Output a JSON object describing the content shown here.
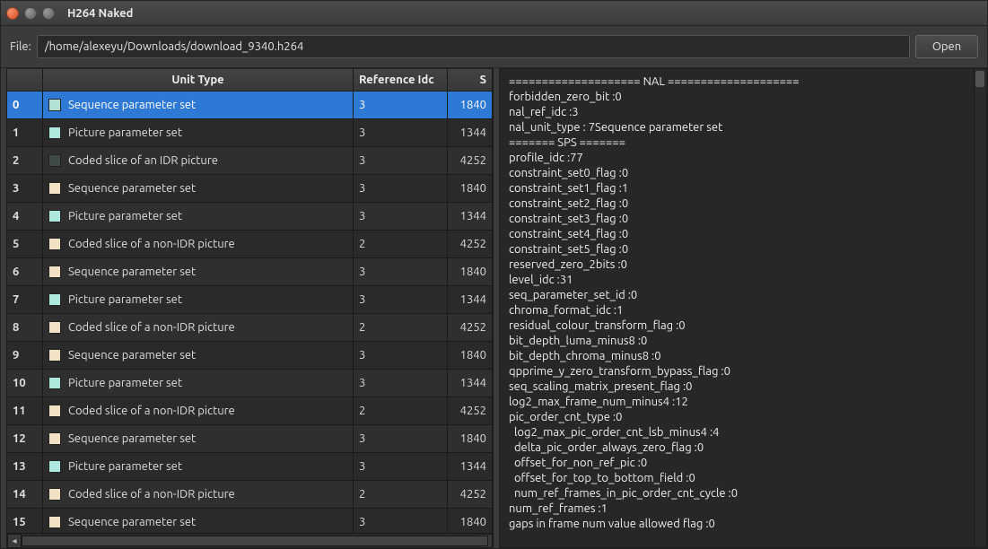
{
  "window": {
    "title": "H264 Naked"
  },
  "toolbar": {
    "file_label": "File:",
    "path": "/home/alexeyu/Downloads/download_9340.h264",
    "open_label": "Open"
  },
  "table": {
    "headers": {
      "type": "Unit Type",
      "ref": "Reference Idc",
      "size": "S"
    },
    "selected_index": 0,
    "rows": [
      {
        "idx": 0,
        "type": "Sequence parameter set",
        "ref": 3,
        "size": 1840,
        "color": "#b1e2d5"
      },
      {
        "idx": 1,
        "type": "Picture parameter set",
        "ref": 3,
        "size": 1344,
        "color": "#aee7dd"
      },
      {
        "idx": 2,
        "type": "Coded slice of an IDR picture",
        "ref": 3,
        "size": 4252,
        "color": "#3e4a44"
      },
      {
        "idx": 3,
        "type": "Sequence parameter set",
        "ref": 3,
        "size": 1840,
        "color": "#f2e2c4"
      },
      {
        "idx": 4,
        "type": "Picture parameter set",
        "ref": 3,
        "size": 1344,
        "color": "#aee7dd"
      },
      {
        "idx": 5,
        "type": "Coded slice of a non-IDR picture",
        "ref": 2,
        "size": 4252,
        "color": "#f2e2c4"
      },
      {
        "idx": 6,
        "type": "Sequence parameter set",
        "ref": 3,
        "size": 1840,
        "color": "#f2e2c4"
      },
      {
        "idx": 7,
        "type": "Picture parameter set",
        "ref": 3,
        "size": 1344,
        "color": "#aee7dd"
      },
      {
        "idx": 8,
        "type": "Coded slice of a non-IDR picture",
        "ref": 2,
        "size": 4252,
        "color": "#f2e2c4"
      },
      {
        "idx": 9,
        "type": "Sequence parameter set",
        "ref": 3,
        "size": 1840,
        "color": "#f2e2c4"
      },
      {
        "idx": 10,
        "type": "Picture parameter set",
        "ref": 3,
        "size": 1344,
        "color": "#aee7dd"
      },
      {
        "idx": 11,
        "type": "Coded slice of a non-IDR picture",
        "ref": 2,
        "size": 4252,
        "color": "#f2e2c4"
      },
      {
        "idx": 12,
        "type": "Sequence parameter set",
        "ref": 3,
        "size": 1840,
        "color": "#f2e2c4"
      },
      {
        "idx": 13,
        "type": "Picture parameter set",
        "ref": 3,
        "size": 1344,
        "color": "#aee7dd"
      },
      {
        "idx": 14,
        "type": "Coded slice of a non-IDR picture",
        "ref": 2,
        "size": 4252,
        "color": "#f2e2c4"
      },
      {
        "idx": 15,
        "type": "Sequence parameter set",
        "ref": 3,
        "size": 1840,
        "color": "#f2e2c4"
      }
    ]
  },
  "detail_lines": [
    "==================== NAL ====================",
    "forbidden_zero_bit :0",
    "nal_ref_idc :3",
    "nal_unit_type : 7Sequence parameter set",
    "======= SPS =======",
    "profile_idc :77",
    "constraint_set0_flag :0",
    "constraint_set1_flag :1",
    "constraint_set2_flag :0",
    "constraint_set3_flag :0",
    "constraint_set4_flag :0",
    "constraint_set5_flag :0",
    "reserved_zero_2bits :0",
    "level_idc :31",
    "seq_parameter_set_id :0",
    "chroma_format_idc :1",
    "residual_colour_transform_flag :0",
    "bit_depth_luma_minus8 :0",
    "bit_depth_chroma_minus8 :0",
    "qpprime_y_zero_transform_bypass_flag :0",
    "seq_scaling_matrix_present_flag :0",
    "log2_max_frame_num_minus4 :12",
    "pic_order_cnt_type :0",
    "  log2_max_pic_order_cnt_lsb_minus4 :4",
    "  delta_pic_order_always_zero_flag :0",
    "  offset_for_non_ref_pic :0",
    "  offset_for_top_to_bottom_field :0",
    "  num_ref_frames_in_pic_order_cnt_cycle :0",
    "num_ref_frames :1",
    "gaps in frame num value allowed flag :0"
  ]
}
